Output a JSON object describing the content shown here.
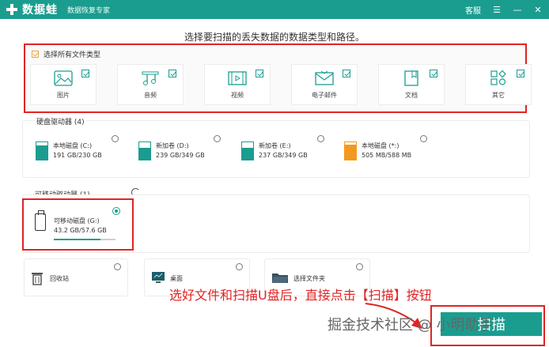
{
  "titlebar": {
    "app_name": "数据蛙",
    "subtitle": "数据恢复专家",
    "service": "客服"
  },
  "heading": "选择要扫描的丢失数据的数据类型和路径。",
  "file_types": {
    "select_all": "选择所有文件类型",
    "items": [
      {
        "label": "图片",
        "icon": "image-icon",
        "checked": true
      },
      {
        "label": "音频",
        "icon": "music-icon",
        "checked": true
      },
      {
        "label": "视频",
        "icon": "video-icon",
        "checked": true
      },
      {
        "label": "电子邮件",
        "icon": "email-icon",
        "checked": true
      },
      {
        "label": "文档",
        "icon": "document-icon",
        "checked": true
      },
      {
        "label": "其它",
        "icon": "other-icon",
        "checked": true
      }
    ]
  },
  "hard_drives": {
    "title": "硬盘驱动器 (4)",
    "items": [
      {
        "name": "本地磁盘 (C:)",
        "size": "191 GB/230 GB",
        "used": 0.83,
        "color": "#1a9d8f"
      },
      {
        "name": "新加卷 (D:)",
        "size": "239 GB/349 GB",
        "used": 0.68,
        "color": "#1a9d8f"
      },
      {
        "name": "新加卷 (E:)",
        "size": "237 GB/349 GB",
        "used": 0.68,
        "color": "#1a9d8f"
      },
      {
        "name": "本地磁盘 (*:)",
        "size": "505 MB/588 MB",
        "used": 0.86,
        "color": "#f39a1e"
      }
    ]
  },
  "removable": {
    "title": "可移动驱动器 (1)",
    "item": {
      "name": "可移动磁盘 (G:)",
      "size": "43.2 GB/57.6 GB",
      "used": 0.75,
      "selected": true
    }
  },
  "locations": [
    {
      "label": "回收站",
      "icon": "trash-icon"
    },
    {
      "label": "桌面",
      "icon": "desktop-icon"
    },
    {
      "label": "选择文件夹",
      "icon": "folder-icon"
    }
  ],
  "annotation": "选好文件和扫描U盘后，直接点击【扫描】按钮",
  "scan_button": "扫描",
  "watermark": "掘金技术社区 @ 小明助手",
  "colors": {
    "accent": "#1a9d8f",
    "highlight": "#e02424",
    "orange": "#f39a1e"
  }
}
